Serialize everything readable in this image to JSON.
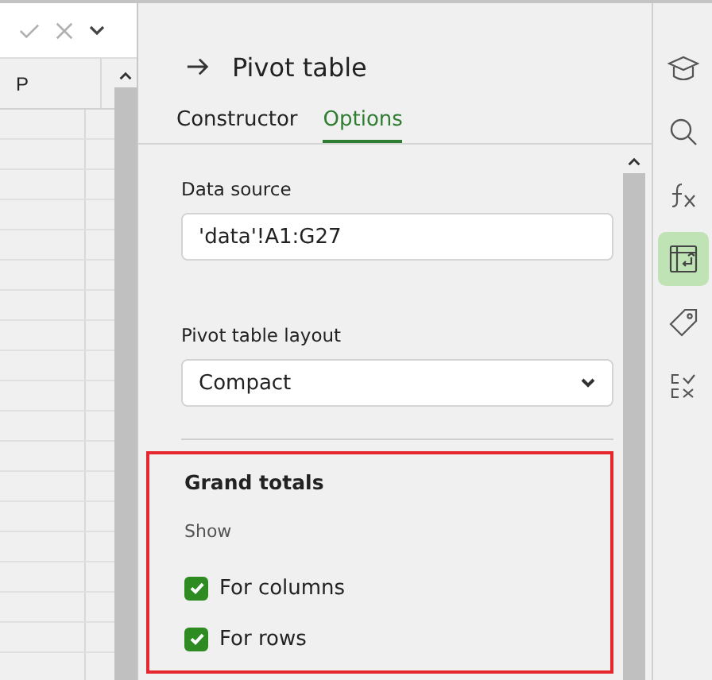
{
  "sheet": {
    "column_headers": [
      "P"
    ]
  },
  "panel": {
    "title": "Pivot table",
    "tabs": [
      {
        "label": "Constructor",
        "selected": false
      },
      {
        "label": "Options",
        "selected": true
      }
    ],
    "data_source": {
      "label": "Data source",
      "value": "'data'!A1:G27"
    },
    "layout": {
      "label": "Pivot table layout",
      "value": "Compact"
    },
    "grand_totals": {
      "title": "Grand totals",
      "subtitle": "Show",
      "options": [
        {
          "label": "For columns",
          "checked": true
        },
        {
          "label": "For rows",
          "checked": true
        }
      ]
    }
  },
  "sidebar": {
    "items": [
      {
        "kind": "learn",
        "selected": false
      },
      {
        "kind": "search",
        "selected": false
      },
      {
        "kind": "function",
        "selected": false
      },
      {
        "kind": "pivot",
        "selected": true
      },
      {
        "kind": "tag",
        "selected": false
      },
      {
        "kind": "check",
        "selected": false
      }
    ]
  }
}
